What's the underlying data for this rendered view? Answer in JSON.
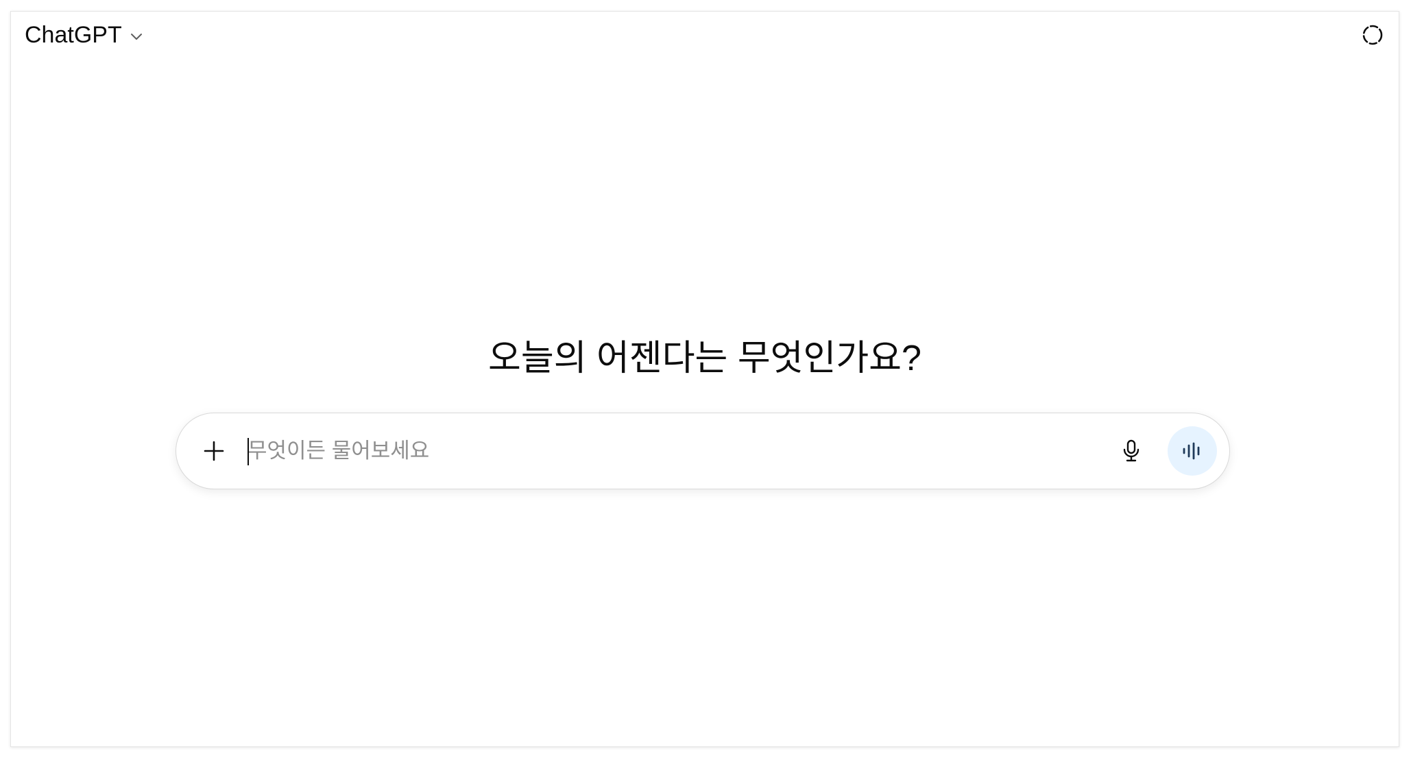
{
  "header": {
    "model_name": "ChatGPT",
    "model_dropdown_icon": "chevron-down-icon",
    "temporary_chat_icon": "dashed-circle-icon"
  },
  "main": {
    "headline": "오늘의 어젠다는 무엇인가요?"
  },
  "composer": {
    "value": "",
    "placeholder": "무엇이든 물어보세요",
    "attach_icon": "plus-icon",
    "dictate_icon": "microphone-icon",
    "voice_mode_icon": "voice-waveform-icon"
  },
  "colors": {
    "text": "#0d0d0d",
    "placeholder": "#8f8f8f",
    "composer_border": "#d9d9d9",
    "voice_button_bg": "#e6f3ff",
    "voice_icon": "#1f3a5a"
  }
}
